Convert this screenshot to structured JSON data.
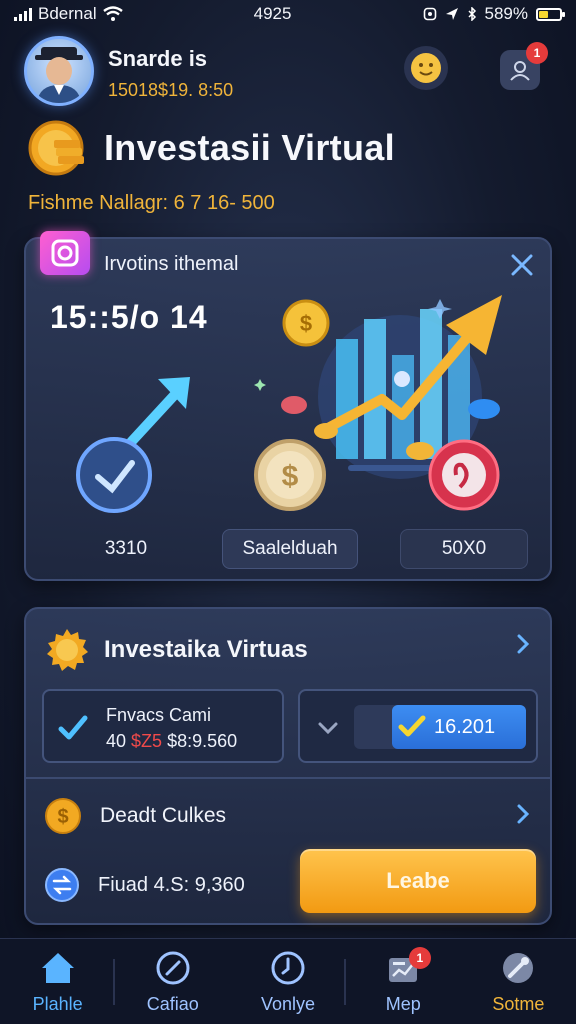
{
  "status_bar": {
    "carrier": "Bdernal",
    "time": "4925",
    "battery_pct": "589%",
    "battery_level": 0.45
  },
  "header": {
    "user_name": "Snarde is",
    "balance": "15018$19. 8:50",
    "profile_badge": "1"
  },
  "title": "Investasii Virtual",
  "subtitle": "Fishme Nallagr: 6  7  16- 500",
  "card1": {
    "title": "Irvotins ithemal",
    "value": "15::5/o  14",
    "stats": [
      "3310",
      "Saalelduah",
      "50X0"
    ]
  },
  "card2": {
    "title": "Investaika Virtuas",
    "box1": {
      "label": "Fnvacs Cami",
      "num": "40",
      "red": "$Z5",
      "amount": "$8:9.560"
    },
    "box2": {
      "value": "16.201"
    },
    "row2_title": "Deadt Culkes",
    "row3_text": "Fiuad  4.S: 9,360",
    "cta": "Leabe"
  },
  "nav": {
    "items": [
      {
        "label": "Plahle",
        "icon": "home-icon"
      },
      {
        "label": "Cafiao",
        "icon": "compass-icon"
      },
      {
        "label": "Vonlye",
        "icon": "clock-icon"
      },
      {
        "label": "Mep",
        "icon": "chart-icon",
        "badge": "1"
      },
      {
        "label": "Sotme",
        "icon": "settings-icon"
      }
    ]
  },
  "colors": {
    "accent": "#5ab4ff",
    "gold": "#f0b43a",
    "cta": "#f5a623"
  }
}
